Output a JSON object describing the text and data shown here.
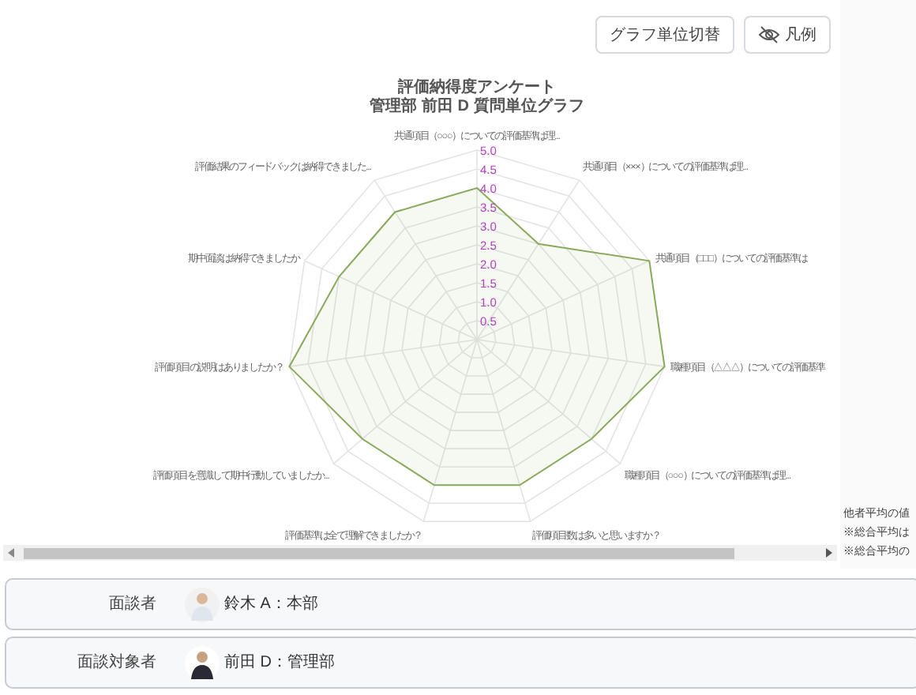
{
  "toolbar": {
    "buttons": [
      {
        "label": "グラフ単位切替",
        "kind": "text"
      },
      {
        "label": "凡例",
        "kind": "legend"
      }
    ]
  },
  "radar": {
    "title_lines": [
      "評価納得度アンケート",
      "管理部 前田 D 質問単位グラフ"
    ],
    "ticks": [
      "5.0",
      "4.5",
      "4.0",
      "3.5",
      "3.0",
      "2.5",
      "2.0",
      "1.5",
      "1.0",
      "0.5"
    ],
    "axis_labels": [
      "共通項目（○○○）についての評価基準は理...",
      "評価結果のフィードバックは納得できました...",
      "共通項目（×××）についての評価基準は理...",
      "期中面談は納得できましたか",
      "共通項目（□□□）についての評価基準は",
      "評価項目の説明はありましたか？",
      "職種項目（△△△）についての評価基準",
      "評価項目を意識して期中行動していましたか...",
      "職種項目（○○○）についての評価基準は理...",
      "評価基準は全て理解できましたか？",
      "評価項目数は多いと思いますか？"
    ]
  },
  "side_notes": [
    "他者平均の値",
    "※総合平均は",
    "※総合平均の"
  ],
  "participants": [
    {
      "role": "面談者",
      "name": "鈴木 A：本部"
    },
    {
      "role": "面談対象者",
      "name": "前田 D：管理部"
    }
  ]
}
